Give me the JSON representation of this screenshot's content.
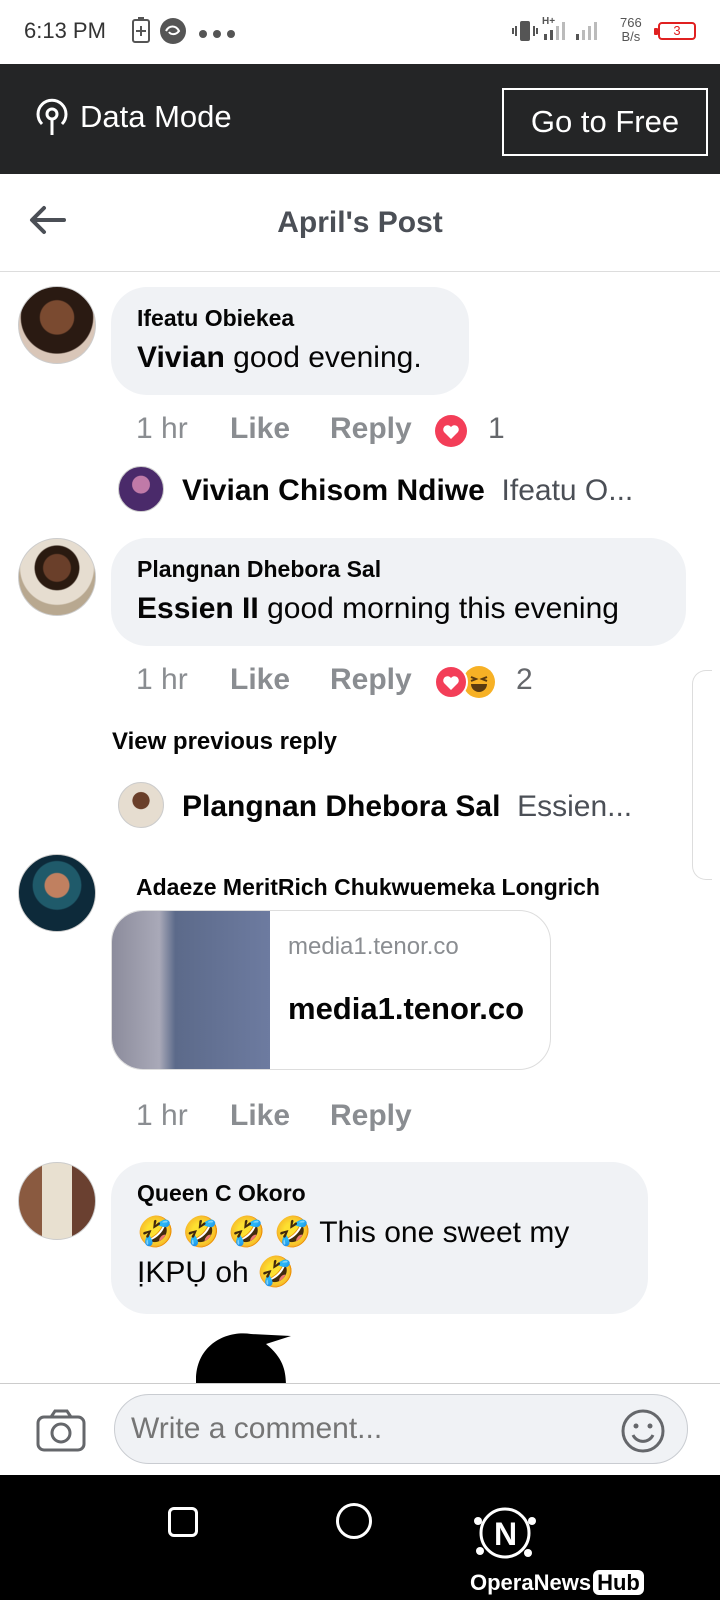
{
  "status_bar": {
    "time": "6:13 PM",
    "net_speed_value": "766",
    "net_speed_unit": "B/s",
    "battery": "3",
    "network_type": "H+"
  },
  "data_bar": {
    "label": "Data Mode",
    "free_button": "Go to Free"
  },
  "header": {
    "title": "April's Post"
  },
  "comments": [
    {
      "author": "Ifeatu Obiekea",
      "mention": "Vivian",
      "text": " good evening.",
      "time": "1 hr",
      "like": "Like",
      "reply": "Reply",
      "reaction_count": "1",
      "reply_preview": {
        "author": "Vivian Chisom Ndiwe",
        "snippet": "Ifeatu O..."
      }
    },
    {
      "author": "Plangnan Dhebora Sal",
      "mention": "Essien II",
      "text": " good morning this evening",
      "time": "1 hr",
      "like": "Like",
      "reply": "Reply",
      "reaction_count": "2",
      "view_previous": "View previous reply",
      "reply_preview": {
        "author": "Plangnan Dhebora Sal",
        "snippet": "Essien..."
      }
    },
    {
      "author": "Adaeze MeritRich Chukwuemeka Longrich",
      "link_domain": "media1.tenor.co",
      "link_title": "media1.tenor.co",
      "time": "1 hr",
      "like": "Like",
      "reply": "Reply"
    },
    {
      "author": "Queen C Okoro",
      "text_line1": "🤣 🤣 🤣 🤣 This one sweet my",
      "text_line2": "ỊKPỤ oh 🤣"
    }
  ],
  "composer": {
    "placeholder": "Write a comment..."
  },
  "watermark": {
    "brand": "OperaNews",
    "hub": "Hub"
  },
  "colors": {
    "dark_bar": "#242526",
    "bubble": "#f0f2f5",
    "meta": "#8a8d91",
    "love": "#f33e58",
    "haha": "#f7b125"
  }
}
